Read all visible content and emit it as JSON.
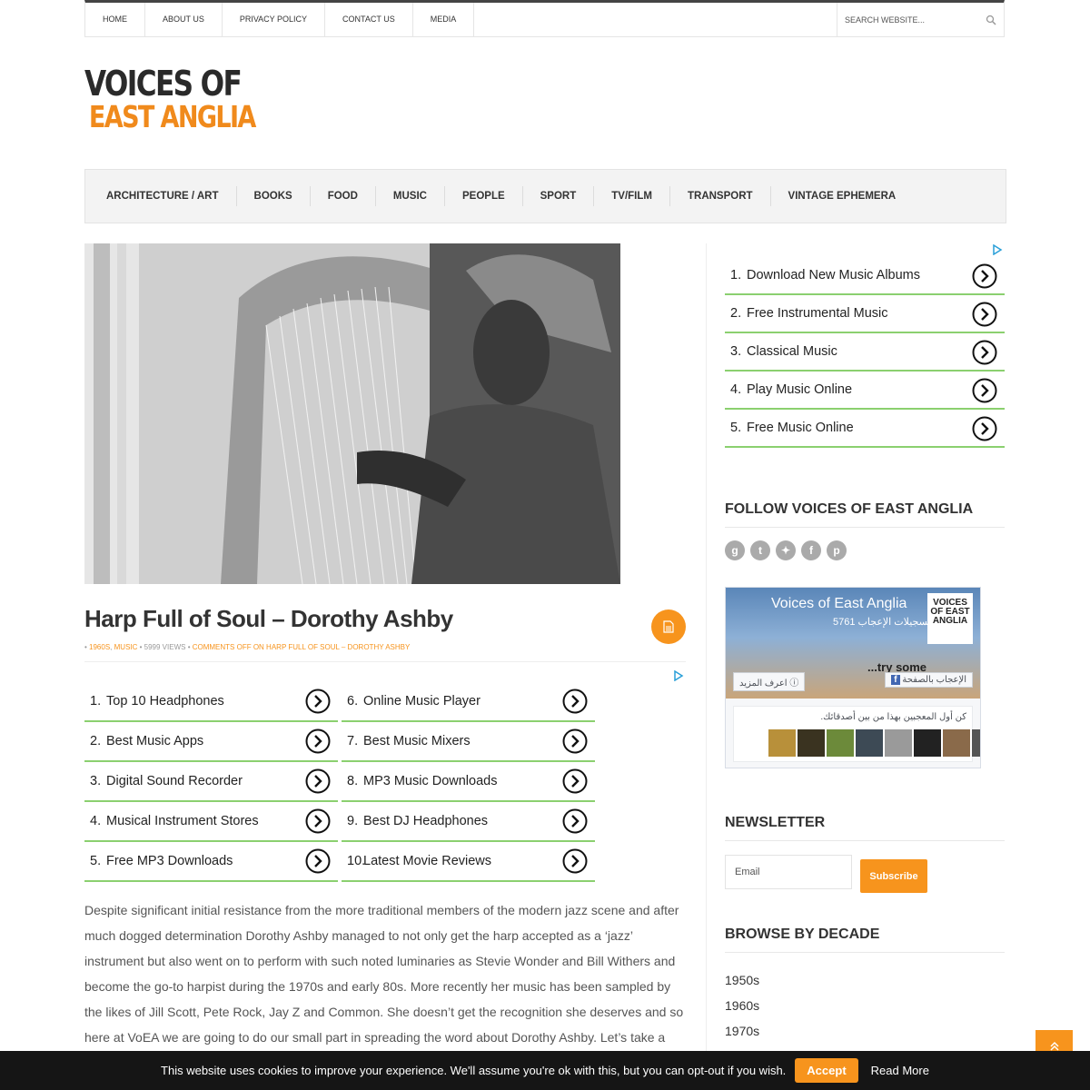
{
  "topnav": {
    "links": [
      "HOME",
      "ABOUT US",
      "PRIVACY POLICY",
      "CONTACT US",
      "MEDIA"
    ],
    "search_placeholder": "SEARCH WEBSITE..."
  },
  "logo": {
    "line1": "VOICES OF",
    "line2": "EAST ANGLIA"
  },
  "categories": [
    "ARCHITECTURE / ART",
    "BOOKS",
    "FOOD",
    "MUSIC",
    "PEOPLE",
    "SPORT",
    "TV/FILM",
    "TRANSPORT",
    "VINTAGE EPHEMERA"
  ],
  "post": {
    "title": "Harp Full of Soul – Dorothy Ashby",
    "meta": {
      "cat1": "1960S",
      "cat2": "MUSIC",
      "views": "5999 VIEWS",
      "comments": "COMMENTS OFF ON HARP FULL OF SOUL – DOROTHY ASHBY"
    },
    "body": "Despite significant initial resistance from the more traditional members of the modern jazz scene and after much dogged determination Dorothy Ashby managed to not only get the harp accepted as a ‘jazz’ instrument but also went on to perform with such noted luminaries as Stevie Wonder and Bill Withers and become the go-to harpist during the 1970s and early 80s. More recently her music has been sampled by the likes of Jill Scott, Pete Rock, Jay Z and Common. She doesn’t get the recognition she deserves and so here at VoEA we are going to do our small part in spreading the word about Dorothy Ashby. Let’s take a brief look at the life and music of a uniquely"
  },
  "main_ads": [
    {
      "num": "1.",
      "label": "Top 10 Headphones"
    },
    {
      "num": "6.",
      "label": "Online Music Player"
    },
    {
      "num": "2.",
      "label": "Best Music Apps"
    },
    {
      "num": "7.",
      "label": "Best Music Mixers"
    },
    {
      "num": "3.",
      "label": "Digital Sound Recorder"
    },
    {
      "num": "8.",
      "label": "MP3 Music Downloads"
    },
    {
      "num": "4.",
      "label": "Musical Instrument Stores"
    },
    {
      "num": "9.",
      "label": "Best DJ Headphones"
    },
    {
      "num": "5.",
      "label": "Free MP3 Downloads"
    },
    {
      "num": "10.",
      "label": "Latest Movie Reviews"
    }
  ],
  "side_ads": [
    {
      "num": "1.",
      "label": "Download New Music Albums"
    },
    {
      "num": "2.",
      "label": "Free Instrumental Music"
    },
    {
      "num": "3.",
      "label": "Classical Music"
    },
    {
      "num": "4.",
      "label": "Play Music Online"
    },
    {
      "num": "5.",
      "label": "Free Music Online"
    }
  ],
  "sidebar": {
    "follow_title": "FOLLOW VOICES OF EAST ANGLIA",
    "social_icons": [
      "google-plus-icon",
      "tumblr-icon",
      "twitter-icon",
      "facebook-icon",
      "pinterest-icon"
    ],
    "fb": {
      "page_name": "Voices of East Anglia",
      "likes": "5761 تسجيلات الإعجاب",
      "logo": "VOICES OF EAST ANGLIA",
      "cover_text": "...try some",
      "like_button": "الإعجاب بالصفحة",
      "learn_more": "اعرف المزيد",
      "friends_text": "كن أول المعجبين بهذا من بين أصدقائك."
    },
    "newsletter_title": "NEWSLETTER",
    "email_placeholder": "Email",
    "subscribe_label": "Subscribe",
    "browse_title": "BROWSE BY DECADE",
    "decades": [
      "1950s",
      "1960s",
      "1970s"
    ]
  },
  "cookie": {
    "message": "This website uses cookies to improve your experience. We'll assume you're ok with this, but you can opt-out if you wish.",
    "accept": "Accept",
    "read_more": "Read More"
  },
  "colors": {
    "accent": "#f7941d",
    "ad_underline": "#8bd06f",
    "dark": "#151515"
  }
}
